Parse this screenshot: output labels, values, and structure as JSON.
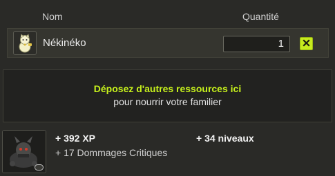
{
  "header": {
    "name_col": "Nom",
    "qty_col": "Quantité"
  },
  "item": {
    "name": "Nékinéko",
    "quantity": "1",
    "icon": "white-cat-figurine-icon",
    "remove_icon": "close-icon"
  },
  "dropzone": {
    "title": "Déposez d'autres ressources ici",
    "subtitle": "pour nourrir votre familier"
  },
  "pet": {
    "icon": "pet-portrait-icon",
    "xp_gain": "+ 392 XP",
    "level_gain": "+ 34 niveaux",
    "bonus": "+ 17 Dommages Critiques"
  },
  "colors": {
    "accent": "#c7f21c",
    "background": "#2a2a27",
    "panel": "#222220"
  }
}
